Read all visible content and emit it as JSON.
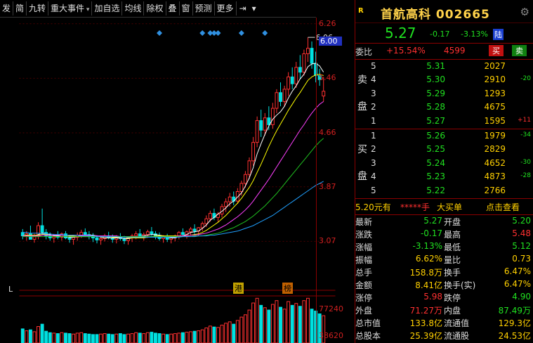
{
  "toolbar": {
    "items": [
      "发",
      "简",
      "九转",
      "重大事件",
      "加自选",
      "均线",
      "除权",
      "叠",
      "窗",
      "预测",
      "更多"
    ],
    "dropdowns": [
      false,
      false,
      false,
      true,
      false,
      false,
      false,
      false,
      false,
      false,
      false
    ]
  },
  "stock": {
    "badge": "R",
    "name": "首航高科 002665",
    "price": "5.27",
    "change": "-0.17",
    "change_pct": "-3.13%",
    "market": "陆"
  },
  "weibi": {
    "label": "委比",
    "ratio": "+15.54%",
    "diff": "4599",
    "buy_label": "买",
    "sell_label": "卖"
  },
  "sell_side_label": [
    "卖",
    "盘"
  ],
  "buy_side_label": [
    "买",
    "盘"
  ],
  "sell_orders": [
    {
      "level": "5",
      "price": "5.31",
      "qty": "2027",
      "delta": "",
      "dir": ""
    },
    {
      "level": "4",
      "price": "5.30",
      "qty": "2910",
      "delta": "-20",
      "dir": "dn"
    },
    {
      "level": "3",
      "price": "5.29",
      "qty": "1293",
      "delta": "",
      "dir": ""
    },
    {
      "level": "2",
      "price": "5.28",
      "qty": "4675",
      "delta": "",
      "dir": ""
    },
    {
      "level": "1",
      "price": "5.27",
      "qty": "1595",
      "delta": "+11",
      "dir": "up"
    }
  ],
  "buy_orders": [
    {
      "level": "1",
      "price": "5.26",
      "qty": "1979",
      "delta": "-34",
      "dir": "dn"
    },
    {
      "level": "2",
      "price": "5.25",
      "qty": "2829",
      "delta": "",
      "dir": ""
    },
    {
      "level": "3",
      "price": "5.24",
      "qty": "4652",
      "delta": "-30",
      "dir": "dn"
    },
    {
      "level": "4",
      "price": "5.23",
      "qty": "4873",
      "delta": "-28",
      "dir": "dn"
    },
    {
      "level": "5",
      "price": "5.22",
      "qty": "2766",
      "delta": "",
      "dir": ""
    }
  ],
  "big_order": {
    "price_text": "5.20元有",
    "stars": "*****手",
    "label": "大买单",
    "link": "点击查看"
  },
  "stats": [
    {
      "k1": "最新",
      "v1": "5.27",
      "c1": "grn",
      "k2": "开盘",
      "v2": "5.20",
      "c2": "grn"
    },
    {
      "k1": "涨跌",
      "v1": "-0.17",
      "c1": "grn",
      "k2": "最高",
      "v2": "5.48",
      "c2": "red"
    },
    {
      "k1": "涨幅",
      "v1": "-3.13%",
      "c1": "grn",
      "k2": "最低",
      "v2": "5.12",
      "c2": "grn"
    },
    {
      "k1": "振幅",
      "v1": "6.62%",
      "c1": "yel",
      "k2": "量比",
      "v2": "0.73",
      "c2": "yel"
    },
    {
      "k1": "总手",
      "v1": "158.8万",
      "c1": "yel",
      "k2": "换手",
      "v2": "6.47%",
      "c2": "yel"
    },
    {
      "k1": "金额",
      "v1": "8.41亿",
      "c1": "yel",
      "k2": "换手(实)",
      "v2": "6.47%",
      "c2": "yel"
    },
    {
      "k1": "涨停",
      "v1": "5.98",
      "c1": "red",
      "k2": "跌停",
      "v2": "4.90",
      "c2": "grn"
    },
    {
      "k1": "外盘",
      "v1": "71.27万",
      "c1": "red",
      "k2": "内盘",
      "v2": "87.49万",
      "c2": "grn"
    },
    {
      "k1": "总市值",
      "v1": "133.8亿",
      "c1": "yel",
      "k2": "流通值",
      "v2": "129.3亿",
      "c2": "yel"
    },
    {
      "k1": "总股本",
      "v1": "25.39亿",
      "c1": "yel",
      "k2": "流通股",
      "v2": "24.53亿",
      "c2": "yel"
    }
  ],
  "axis": {
    "price_ticks": [
      "6.26",
      "6.00",
      "5.46",
      "4.66",
      "3.87",
      "3.07"
    ],
    "highlight_tick": "6.00",
    "volume_ticks": [
      "77240",
      "38620"
    ]
  },
  "chart_labels": {
    "high_marker": "6.06",
    "period": "L",
    "tag1": "港",
    "tag2": "榜"
  },
  "chart_data": {
    "type": "candlestick",
    "ohlc": [
      [
        3.2,
        3.25,
        3.1,
        3.15
      ],
      [
        3.15,
        3.22,
        3.08,
        3.18
      ],
      [
        3.18,
        3.3,
        3.12,
        3.1
      ],
      [
        3.1,
        3.18,
        3.05,
        3.14
      ],
      [
        3.14,
        3.35,
        3.1,
        3.3
      ],
      [
        3.3,
        3.55,
        3.25,
        3.2
      ],
      [
        3.2,
        3.25,
        3.1,
        3.15
      ],
      [
        3.15,
        3.2,
        3.08,
        3.12
      ],
      [
        3.12,
        3.18,
        3.05,
        3.16
      ],
      [
        3.16,
        3.22,
        3.1,
        3.13
      ],
      [
        3.13,
        3.2,
        3.08,
        3.18
      ],
      [
        3.18,
        3.22,
        3.1,
        3.12
      ],
      [
        3.12,
        3.16,
        3.05,
        3.1
      ],
      [
        3.1,
        3.15,
        3.02,
        3.13
      ],
      [
        3.13,
        3.2,
        3.08,
        3.16
      ],
      [
        3.16,
        3.24,
        3.12,
        3.2
      ],
      [
        3.2,
        3.26,
        3.14,
        3.17
      ],
      [
        3.17,
        3.22,
        3.1,
        3.14
      ],
      [
        3.14,
        3.19,
        3.06,
        3.12
      ],
      [
        3.12,
        3.16,
        3.04,
        3.09
      ],
      [
        3.09,
        3.14,
        3.02,
        3.11
      ],
      [
        3.11,
        3.18,
        3.07,
        3.15
      ],
      [
        3.15,
        3.21,
        3.1,
        3.12
      ],
      [
        3.12,
        3.17,
        3.05,
        3.1
      ],
      [
        3.1,
        3.16,
        3.04,
        3.13
      ],
      [
        3.13,
        3.19,
        3.08,
        3.11
      ],
      [
        3.11,
        3.15,
        3.03,
        3.08
      ],
      [
        3.08,
        3.14,
        3.02,
        3.12
      ],
      [
        3.12,
        3.18,
        3.06,
        3.15
      ],
      [
        3.15,
        3.22,
        3.1,
        3.18
      ],
      [
        3.18,
        3.25,
        3.12,
        3.14
      ],
      [
        3.14,
        3.2,
        3.08,
        3.17
      ],
      [
        3.17,
        3.24,
        3.12,
        3.21
      ],
      [
        3.21,
        3.28,
        3.15,
        3.18
      ],
      [
        3.18,
        3.22,
        3.1,
        3.14
      ],
      [
        3.14,
        3.2,
        3.08,
        3.11
      ],
      [
        3.11,
        3.16,
        3.05,
        3.13
      ],
      [
        3.13,
        3.18,
        3.06,
        3.1
      ],
      [
        3.1,
        3.15,
        3.04,
        3.12
      ],
      [
        3.12,
        3.17,
        3.07,
        3.15
      ],
      [
        3.15,
        3.22,
        3.1,
        3.2
      ],
      [
        3.2,
        3.26,
        3.14,
        3.17
      ],
      [
        3.17,
        3.23,
        3.11,
        3.21
      ],
      [
        3.21,
        3.28,
        3.16,
        3.25
      ],
      [
        3.25,
        3.32,
        3.18,
        3.22
      ],
      [
        3.22,
        3.28,
        3.15,
        3.27
      ],
      [
        3.27,
        3.36,
        3.22,
        3.33
      ],
      [
        3.33,
        3.45,
        3.28,
        3.4
      ],
      [
        3.4,
        3.52,
        3.36,
        3.48
      ],
      [
        3.48,
        3.55,
        3.38,
        3.42
      ],
      [
        3.42,
        3.5,
        3.35,
        3.47
      ],
      [
        3.47,
        3.62,
        3.42,
        3.58
      ],
      [
        3.58,
        3.7,
        3.5,
        3.65
      ],
      [
        3.65,
        3.78,
        3.58,
        3.72
      ],
      [
        3.72,
        3.8,
        3.6,
        3.66
      ],
      [
        3.66,
        3.85,
        3.62,
        3.8
      ],
      [
        3.8,
        3.96,
        3.74,
        3.92
      ],
      [
        3.92,
        4.1,
        3.86,
        4.05
      ],
      [
        4.05,
        4.3,
        3.98,
        4.25
      ],
      [
        4.25,
        4.6,
        4.18,
        4.52
      ],
      [
        4.52,
        4.9,
        4.45,
        4.84
      ],
      [
        4.84,
        5.0,
        4.6,
        4.7
      ],
      [
        4.7,
        4.95,
        4.62,
        4.88
      ],
      [
        4.88,
        5.05,
        4.7,
        4.78
      ],
      [
        4.78,
        5.1,
        4.72,
        5.02
      ],
      [
        5.02,
        5.3,
        4.95,
        5.25
      ],
      [
        5.25,
        5.4,
        5.05,
        5.12
      ],
      [
        5.12,
        5.35,
        5.05,
        5.3
      ],
      [
        5.3,
        5.55,
        5.2,
        5.48
      ],
      [
        5.48,
        5.62,
        5.3,
        5.38
      ],
      [
        5.38,
        5.7,
        5.32,
        5.62
      ],
      [
        5.62,
        5.8,
        5.45,
        5.55
      ],
      [
        5.55,
        5.88,
        5.5,
        5.82
      ],
      [
        5.82,
        6.06,
        5.7,
        5.9
      ],
      [
        5.9,
        6.0,
        5.6,
        5.68
      ],
      [
        5.68,
        5.85,
        5.4,
        5.5
      ],
      [
        5.5,
        5.6,
        5.35,
        5.44
      ],
      [
        5.2,
        5.48,
        5.12,
        5.27
      ]
    ],
    "ylim": [
      2.95,
      6.35
    ],
    "ma5": [
      3.15,
      3.16,
      3.15,
      3.14,
      3.17,
      3.19,
      3.18,
      3.17,
      3.15,
      3.15,
      3.14,
      3.14,
      3.13,
      3.13,
      3.14,
      3.15,
      3.16,
      3.16,
      3.16,
      3.15,
      3.13,
      3.12,
      3.12,
      3.12,
      3.12,
      3.12,
      3.11,
      3.11,
      3.12,
      3.13,
      3.14,
      3.15,
      3.16,
      3.17,
      3.17,
      3.16,
      3.15,
      3.13,
      3.12,
      3.12,
      3.14,
      3.15,
      3.17,
      3.2,
      3.21,
      3.22,
      3.26,
      3.31,
      3.38,
      3.42,
      3.47,
      3.51,
      3.56,
      3.62,
      3.66,
      3.72,
      3.78,
      3.88,
      4.0,
      4.15,
      4.35,
      4.5,
      4.64,
      4.76,
      4.86,
      4.92,
      4.97,
      5.05,
      5.17,
      5.27,
      5.35,
      5.45,
      5.52,
      5.63,
      5.67,
      5.68,
      5.64,
      5.55
    ],
    "ma10": [
      3.15,
      3.16,
      3.16,
      3.16,
      3.16,
      3.17,
      3.17,
      3.16,
      3.16,
      3.16,
      3.16,
      3.16,
      3.15,
      3.15,
      3.14,
      3.14,
      3.14,
      3.14,
      3.14,
      3.14,
      3.14,
      3.14,
      3.14,
      3.13,
      3.13,
      3.13,
      3.13,
      3.12,
      3.12,
      3.12,
      3.12,
      3.12,
      3.13,
      3.14,
      3.15,
      3.15,
      3.15,
      3.15,
      3.15,
      3.15,
      3.15,
      3.15,
      3.15,
      3.16,
      3.17,
      3.18,
      3.2,
      3.23,
      3.27,
      3.31,
      3.35,
      3.4,
      3.45,
      3.51,
      3.57,
      3.63,
      3.7,
      3.78,
      3.86,
      3.96,
      4.08,
      4.2,
      4.33,
      4.46,
      4.58,
      4.69,
      4.79,
      4.89,
      4.99,
      5.08,
      5.17,
      5.25,
      5.34,
      5.43,
      5.48,
      5.51,
      5.52,
      5.5
    ],
    "ma20": [
      3.15,
      3.15,
      3.15,
      3.15,
      3.15,
      3.16,
      3.16,
      3.16,
      3.16,
      3.16,
      3.16,
      3.16,
      3.16,
      3.16,
      3.16,
      3.16,
      3.16,
      3.16,
      3.15,
      3.15,
      3.15,
      3.15,
      3.15,
      3.15,
      3.15,
      3.14,
      3.14,
      3.14,
      3.14,
      3.14,
      3.14,
      3.14,
      3.14,
      3.14,
      3.14,
      3.14,
      3.14,
      3.14,
      3.14,
      3.14,
      3.15,
      3.15,
      3.15,
      3.16,
      3.16,
      3.17,
      3.18,
      3.19,
      3.21,
      3.23,
      3.25,
      3.28,
      3.31,
      3.35,
      3.39,
      3.43,
      3.48,
      3.53,
      3.59,
      3.66,
      3.74,
      3.82,
      3.9,
      3.98,
      4.07,
      4.16,
      4.25,
      4.34,
      4.43,
      4.52,
      4.61,
      4.7,
      4.78,
      4.87,
      4.95,
      5.02,
      5.08,
      5.12
    ],
    "ma30": [
      3.14,
      3.14,
      3.14,
      3.14,
      3.14,
      3.14,
      3.14,
      3.14,
      3.14,
      3.14,
      3.14,
      3.14,
      3.14,
      3.14,
      3.14,
      3.14,
      3.14,
      3.14,
      3.14,
      3.14,
      3.14,
      3.14,
      3.14,
      3.14,
      3.14,
      3.14,
      3.14,
      3.14,
      3.14,
      3.14,
      3.14,
      3.14,
      3.14,
      3.14,
      3.14,
      3.14,
      3.14,
      3.14,
      3.14,
      3.14,
      3.14,
      3.14,
      3.14,
      3.14,
      3.15,
      3.15,
      3.15,
      3.16,
      3.17,
      3.18,
      3.19,
      3.21,
      3.23,
      3.25,
      3.27,
      3.3,
      3.33,
      3.36,
      3.4,
      3.44,
      3.49,
      3.54,
      3.59,
      3.65,
      3.71,
      3.77,
      3.84,
      3.91,
      3.98,
      4.05,
      4.12,
      4.19,
      4.26,
      4.33,
      4.4,
      4.47,
      4.53,
      4.58
    ],
    "ma60": [
      3.2,
      3.2,
      3.19,
      3.19,
      3.19,
      3.18,
      3.18,
      3.18,
      3.17,
      3.17,
      3.17,
      3.16,
      3.16,
      3.16,
      3.16,
      3.15,
      3.15,
      3.15,
      3.15,
      3.14,
      3.14,
      3.14,
      3.14,
      3.14,
      3.14,
      3.13,
      3.13,
      3.13,
      3.13,
      3.13,
      3.13,
      3.13,
      3.13,
      3.13,
      3.13,
      3.13,
      3.13,
      3.13,
      3.13,
      3.13,
      3.13,
      3.14,
      3.14,
      3.14,
      3.14,
      3.15,
      3.15,
      3.15,
      3.16,
      3.16,
      3.17,
      3.18,
      3.19,
      3.2,
      3.21,
      3.22,
      3.24,
      3.26,
      3.28,
      3.3,
      3.33,
      3.36,
      3.39,
      3.42,
      3.45,
      3.49,
      3.53,
      3.57,
      3.61,
      3.65,
      3.69,
      3.73,
      3.77,
      3.81,
      3.85,
      3.89,
      3.92,
      3.95
    ],
    "volume_ylim": [
      0,
      100000
    ],
    "volume": [
      30000,
      26000,
      28000,
      24000,
      35000,
      40000,
      25000,
      22000,
      21000,
      20000,
      22000,
      21000,
      20000,
      19000,
      21000,
      22000,
      20000,
      19000,
      18000,
      18000,
      19000,
      20000,
      19000,
      18000,
      19000,
      20000,
      18000,
      19000,
      20000,
      22000,
      21000,
      20000,
      22000,
      23000,
      21000,
      20000,
      19000,
      18000,
      19000,
      20000,
      21000,
      22000,
      23000,
      24000,
      25000,
      26000,
      28000,
      32000,
      36000,
      34000,
      33000,
      38000,
      42000,
      45000,
      40000,
      48000,
      55000,
      60000,
      70000,
      85000,
      95000,
      80000,
      75000,
      70000,
      82000,
      90000,
      76000,
      72000,
      88000,
      80000,
      84000,
      78000,
      90000,
      95000,
      72000,
      68000,
      62000,
      58000
    ],
    "diamond_markers": [
      35,
      46,
      48,
      49,
      50,
      56,
      62
    ]
  }
}
